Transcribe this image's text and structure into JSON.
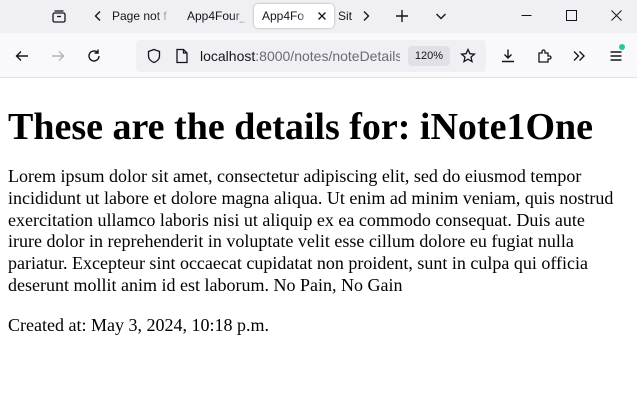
{
  "browser": {
    "tabs": [
      {
        "label": "Page not f"
      },
      {
        "label": "App4Four_"
      },
      {
        "label": "App4Fo",
        "active": true
      },
      {
        "label": "Sit"
      }
    ],
    "url_host": "localhost",
    "url_path": ":8000/notes/noteDetails",
    "zoom": "120%",
    "icons": [
      "tab-list-icon",
      "scroll-left-icon",
      "close-tab-icon",
      "scroll-right-icon",
      "new-tab-icon",
      "list-all-tabs-icon",
      "minimize-icon",
      "maximize-icon",
      "close-window-icon",
      "back-icon",
      "forward-icon",
      "reload-icon",
      "tracking-shield-icon",
      "page-info-icon",
      "bookmark-star-icon",
      "downloads-icon",
      "extensions-icon",
      "overflow-chevrons-icon",
      "menu-icon"
    ],
    "accent_color": "#2ac3a2"
  },
  "page": {
    "heading": "These are the details for: iNote1One",
    "body": "Lorem ipsum dolor sit amet, consectetur adipiscing elit, sed do eiusmod tempor incididunt ut labore et dolore magna aliqua. Ut enim ad minim veniam, quis nostrud exercitation ullamco laboris nisi ut aliquip ex ea commodo consequat. Duis aute irure dolor in reprehenderit in voluptate velit esse cillum dolore eu fugiat nulla pariatur. Excepteur sint occaecat cupidatat non proident, sunt in culpa qui officia deserunt mollit anim id est laborum. No Pain, No Gain",
    "created": "Created at: May 3, 2024, 10:18 p.m."
  }
}
